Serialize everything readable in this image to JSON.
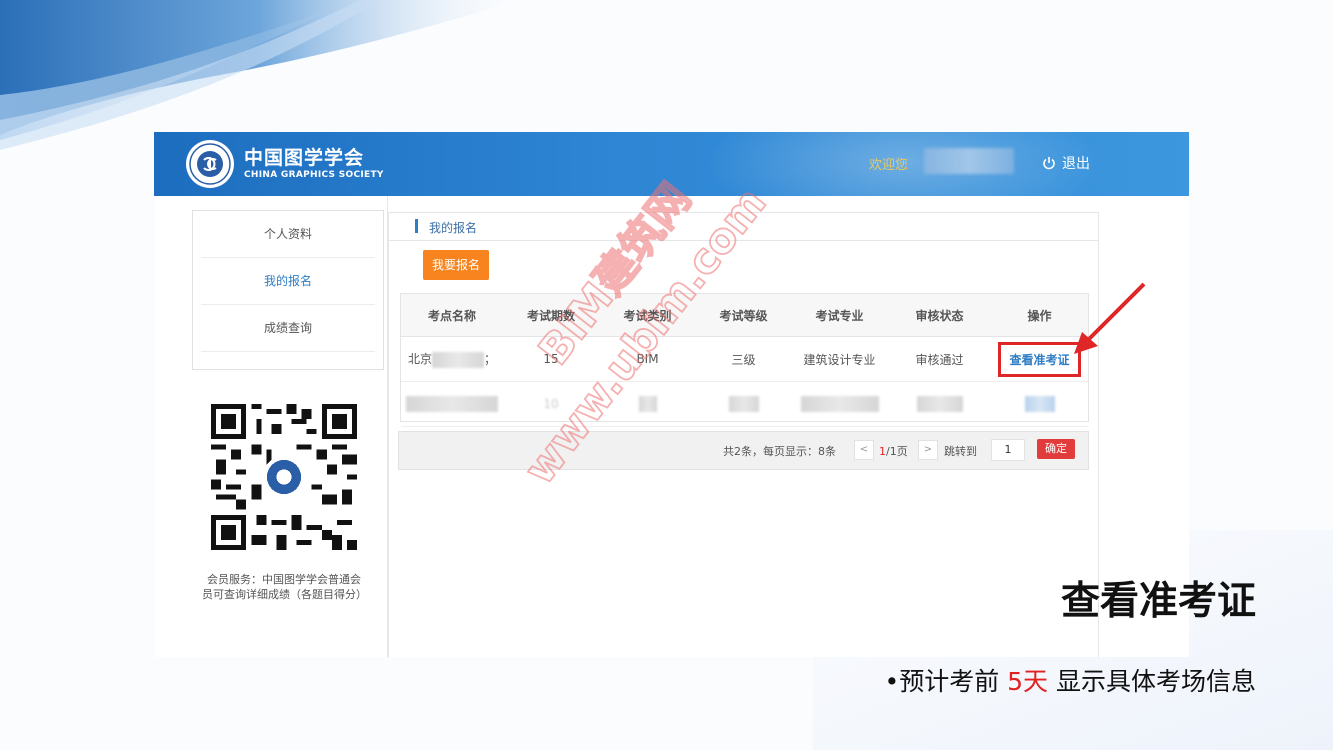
{
  "header": {
    "logo_cn": "中国图学学会",
    "logo_en": "CHINA GRAPHICS SOCIETY",
    "welcome": "欢迎您",
    "logout": "退出"
  },
  "sidebar": {
    "items": [
      {
        "label": "个人资料"
      },
      {
        "label": "我的报名"
      },
      {
        "label": "成绩查询"
      }
    ],
    "qr_caption": "会员服务：中国图学学会普通会员可查询详细成绩（各题目得分）"
  },
  "main": {
    "section_title": "我的报名",
    "register_button": "我要报名",
    "table": {
      "columns": [
        "考点名称",
        "考试期数",
        "考试类别",
        "考试等级",
        "考试专业",
        "审核状态",
        "操作"
      ],
      "rows": [
        {
          "site": "北京",
          "site_tail": "；",
          "period": "15",
          "category": "BIM",
          "level": "三级",
          "major": "建筑设计专业",
          "status": "审核通过",
          "action": "查看准考证"
        },
        {
          "period": "10"
        }
      ]
    },
    "pager": {
      "summary": "共2条，每页显示：8条",
      "prev": "<",
      "current": "1",
      "total": "/1页",
      "next": ">",
      "jump_label": "跳转到",
      "jump_value": "1",
      "confirm": "确定"
    }
  },
  "watermark": {
    "line1": "BIM建筑网",
    "line2": "www.ubim.com"
  },
  "slide": {
    "title": "查看准考证",
    "note_bullet": "•",
    "note_before": "预计考前 ",
    "note_highlight": "5天",
    "note_after": " 显示具体考场信息"
  },
  "colors": {
    "header_blue": "#2e86d4",
    "accent_orange": "#f7841f",
    "highlight_red": "#e02727",
    "link_blue": "#2f7dc4",
    "welcome_gold": "#e6c965"
  }
}
